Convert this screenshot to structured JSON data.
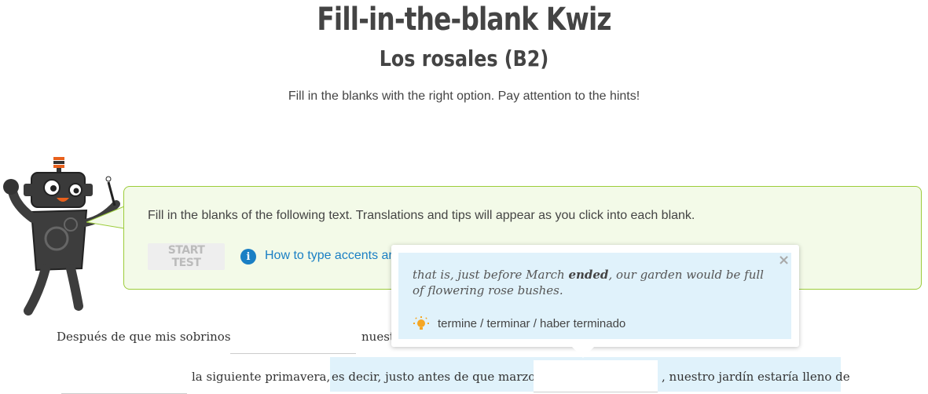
{
  "header": {
    "title": "Fill-in-the-blank Kwiz",
    "subtitle": "Los rosales (B2)",
    "intro": "Fill in the blanks with the right option. Pay attention to the hints!"
  },
  "instructions": {
    "text": "Fill in the blanks of the following text. Translations and tips will appear as you click into each blank.",
    "start_label": "START TEST",
    "accents_link": "How to type accents ar"
  },
  "tooltip": {
    "translation_pre": "that is, just before March ",
    "translation_bold": "ended",
    "translation_post": ", our garden would be full of flowering rose bushes.",
    "hint": "termine / terminar / haber terminado",
    "close_symbol": "×"
  },
  "exercise": {
    "line1_a": "Después de que mis sobrinos",
    "line1_b": "nuest",
    "line2_a": "la siguiente primavera,",
    "line2_b": "es decir, justo antes de que marzo",
    "line2_c": ", nuestro jardín estaría lleno de"
  },
  "colors": {
    "accent": "#1a7fc4",
    "instruction_bg": "#f3fae8",
    "instruction_border": "#9ccc3a",
    "tooltip_bg": "#e0f2fb"
  },
  "icons": {
    "info": "info-icon",
    "hint": "lightbulb-icon",
    "close": "close-icon",
    "mascot": "robot-mascot"
  }
}
